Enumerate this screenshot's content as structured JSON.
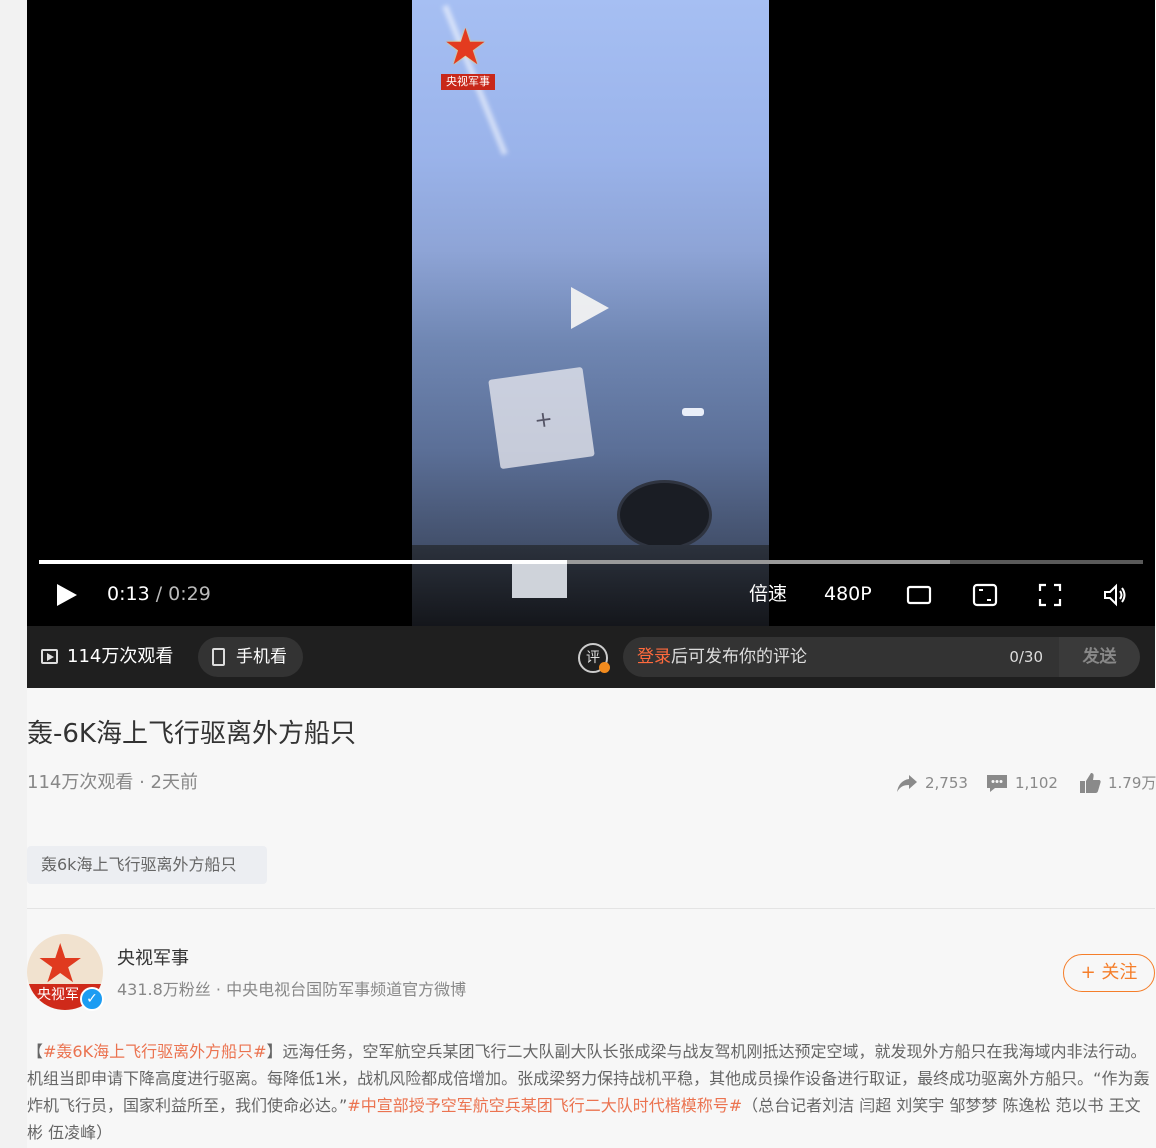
{
  "player": {
    "watermark_text": "央视军事",
    "current_time": "0:13",
    "separator": "/",
    "duration": "0:29",
    "played_fraction": 0.478,
    "buffered_fraction": 0.825,
    "speed_label": "倍速",
    "quality_label": "480P",
    "icons": [
      "play-icon",
      "theater-mode-icon",
      "picture-in-picture-icon",
      "fullscreen-icon",
      "volume-icon"
    ]
  },
  "bar": {
    "views": "114万次观看",
    "mobile_watch": "手机看",
    "comment_icon_text": "评",
    "comment_login": "登录",
    "comment_placeholder": "后可发布你的评论",
    "comment_count": "0/30",
    "send_label": "发送"
  },
  "video": {
    "title": "轰-6K海上飞行驱离外方船只",
    "meta": "114万次观看 · 2天前",
    "shares": "2,753",
    "comments": "1,102",
    "likes": "1.79万",
    "tag": "轰6k海上飞行驱离外方船只"
  },
  "author": {
    "avatar_text": "央视军",
    "name": "央视军事",
    "desc": "431.8万粉丝 · 中央电视台国防军事频道官方微博",
    "follow_label": "+ 关注"
  },
  "description": {
    "p1": "【",
    "hashtag1": "#轰6K海上飞行驱离外方船只#",
    "p2": "】远海任务，空军航空兵某团飞行二大队副大队长张成梁与战友驾机刚抵达预定空域，就发现外方船只在我海域内非法行动。机组当即申请下降高度进行驱离。每降低1米，战机风险都成倍增加。张成梁努力保持战机平稳，其他成员操作设备进行取证，最终成功驱离外方船只。“作为轰炸机飞行员，国家利益所至，我们使命必达。”",
    "hashtag2": "#中宣部授予空军航空兵某团飞行二大队时代楷模称号#",
    "p3": "（总台记者刘洁 闫超 刘笑宇 邹梦梦 陈逸松 范以书 王文彬 伍凌峰）"
  },
  "colors": {
    "accent_orange": "#f57e2a",
    "hashtag": "#eb7350",
    "verify_blue": "#1c9cf2"
  }
}
